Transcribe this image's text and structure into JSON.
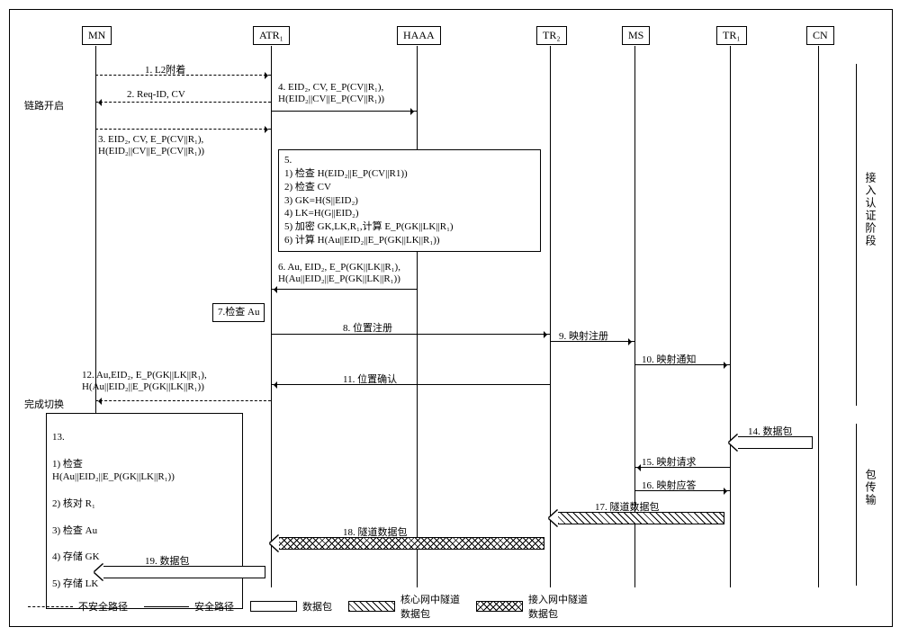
{
  "actors": {
    "mn": "MN",
    "atr1": "ATR₁",
    "haaa": "HAAA",
    "tr2": "TR₂",
    "ms": "MS",
    "tr1": "TR₁",
    "cn": "CN"
  },
  "side": {
    "linkStart": "链路开启",
    "handoverDone": "完成切换"
  },
  "phase": {
    "auth": "接入认证阶段",
    "pkt": "包传输"
  },
  "m": {
    "m1": "1. L2附着",
    "m2": "2. Req-ID, CV",
    "m3": "3. EID₂, CV, E_P(CV||R₁),\nH(EID₂||CV||E_P(CV||R₁))",
    "m4": "4. EID₂, CV, E_P(CV||R₁),\nH(EID₂||CV||E_P(CV||R₁))",
    "m6": "6. Au, EID₂, E_P(GK||LK||R₁),\nH(Au||EID₂||E_P(GK||LK||R₁))",
    "m7": "7.检查 Au",
    "m8": "8. 位置注册",
    "m9": "9. 映射注册",
    "m10": "10. 映射通知",
    "m11": "11. 位置确认",
    "m12": "12. Au,EID₂, E_P(GK||LK||R₁),\nH(Au||EID₂||E_P(GK||LK||R₁))",
    "m14": "14. 数据包",
    "m15": "15. 映射请求",
    "m16": "16. 映射应答",
    "m17": "17. 隧道数据包",
    "m18": "18. 隧道数据包",
    "m19": "19. 数据包"
  },
  "box5": {
    "title": "5.",
    "l1": "1) 检查 H(EID₂||E_P(CV||R1))",
    "l2": "2) 检查 CV",
    "l3": "3) GK=H(S||EID₂)",
    "l4": "4) LK=H(G||EID₂)",
    "l5": "5) 加密 GK,LK,R₁,计算 E_P(GK||LK||R₁)",
    "l6": "6) 计算 H(Au||EID₂||E_P(GK||LK||R₁))"
  },
  "box13": {
    "title": "13.",
    "l1": "1) 检查\n   H(Au||EID₂||E_P(GK||LK||R₁))",
    "l2": "2) 核对 R₁",
    "l3": "3) 检查 Au",
    "l4": "4) 存储 GK",
    "l5": "5) 存储 LK"
  },
  "legend": {
    "insecure": "不安全路径",
    "secure": "安全路径",
    "packet": "数据包",
    "coreTunnel": "核心网中隧道\n数据包",
    "accessTunnel": "接入网中隧道\n数据包"
  },
  "chart_data": {
    "type": "sequence-diagram",
    "actors": [
      "MN",
      "ATR1",
      "HAAA",
      "TR2",
      "MS",
      "TR1",
      "CN"
    ],
    "messages": [
      {
        "step": 1,
        "from": "MN",
        "to": "ATR1",
        "label": "L2附着",
        "path": "insecure"
      },
      {
        "step": 2,
        "from": "ATR1",
        "to": "MN",
        "label": "Req-ID, CV",
        "path": "insecure"
      },
      {
        "step": 3,
        "from": "MN",
        "to": "ATR1",
        "label": "EID2, CV, E_P(CV||R1), H(EID2||CV||E_P(CV||R1))",
        "path": "insecure"
      },
      {
        "step": 4,
        "from": "ATR1",
        "to": "HAAA",
        "label": "EID2, CV, E_P(CV||R1), H(EID2||CV||E_P(CV||R1))",
        "path": "secure"
      },
      {
        "step": 5,
        "at": "HAAA",
        "type": "process",
        "items": [
          "检查 H(EID2||E_P(CV||R1))",
          "检查 CV",
          "GK=H(S||EID2)",
          "LK=H(G||EID2)",
          "加密 GK,LK,R1,计算 E_P(GK||LK||R1)",
          "计算 H(Au||EID2||E_P(GK||LK||R1))"
        ]
      },
      {
        "step": 6,
        "from": "HAAA",
        "to": "ATR1",
        "label": "Au, EID2, E_P(GK||LK||R1), H(Au||EID2||E_P(GK||LK||R1))",
        "path": "secure"
      },
      {
        "step": 7,
        "at": "ATR1",
        "type": "process",
        "items": [
          "检查 Au"
        ]
      },
      {
        "step": 8,
        "from": "ATR1",
        "to": "TR2",
        "label": "位置注册",
        "path": "secure"
      },
      {
        "step": 9,
        "from": "TR2",
        "to": "MS",
        "label": "映射注册",
        "path": "secure"
      },
      {
        "step": 10,
        "from": "MS",
        "to": "TR1",
        "label": "映射通知",
        "path": "secure"
      },
      {
        "step": 11,
        "from": "TR2",
        "to": "ATR1",
        "label": "位置确认",
        "path": "secure"
      },
      {
        "step": 12,
        "from": "ATR1",
        "to": "MN",
        "label": "Au,EID2, E_P(GK||LK||R1), H(Au||EID2||E_P(GK||LK||R1))",
        "path": "insecure"
      },
      {
        "step": 13,
        "at": "MN",
        "type": "process",
        "items": [
          "检查 H(Au||EID2||E_P(GK||LK||R1))",
          "核对 R1",
          "检查 Au",
          "存储 GK",
          "存储 LK"
        ]
      },
      {
        "step": 14,
        "from": "CN",
        "to": "TR1",
        "label": "数据包",
        "path": "packet"
      },
      {
        "step": 15,
        "from": "TR1",
        "to": "MS",
        "label": "映射请求",
        "path": "secure"
      },
      {
        "step": 16,
        "from": "MS",
        "to": "TR1",
        "label": "映射应答",
        "path": "secure"
      },
      {
        "step": 17,
        "from": "TR1",
        "to": "TR2",
        "label": "隧道数据包",
        "path": "core-tunnel"
      },
      {
        "step": 18,
        "from": "TR2",
        "to": "ATR1",
        "label": "隧道数据包",
        "path": "access-tunnel"
      },
      {
        "step": 19,
        "from": "ATR1",
        "to": "MN",
        "label": "数据包",
        "path": "packet"
      }
    ],
    "phases": [
      {
        "name": "接入认证阶段",
        "steps": [
          1,
          12
        ]
      },
      {
        "name": "包传输",
        "steps": [
          14,
          19
        ]
      }
    ]
  }
}
